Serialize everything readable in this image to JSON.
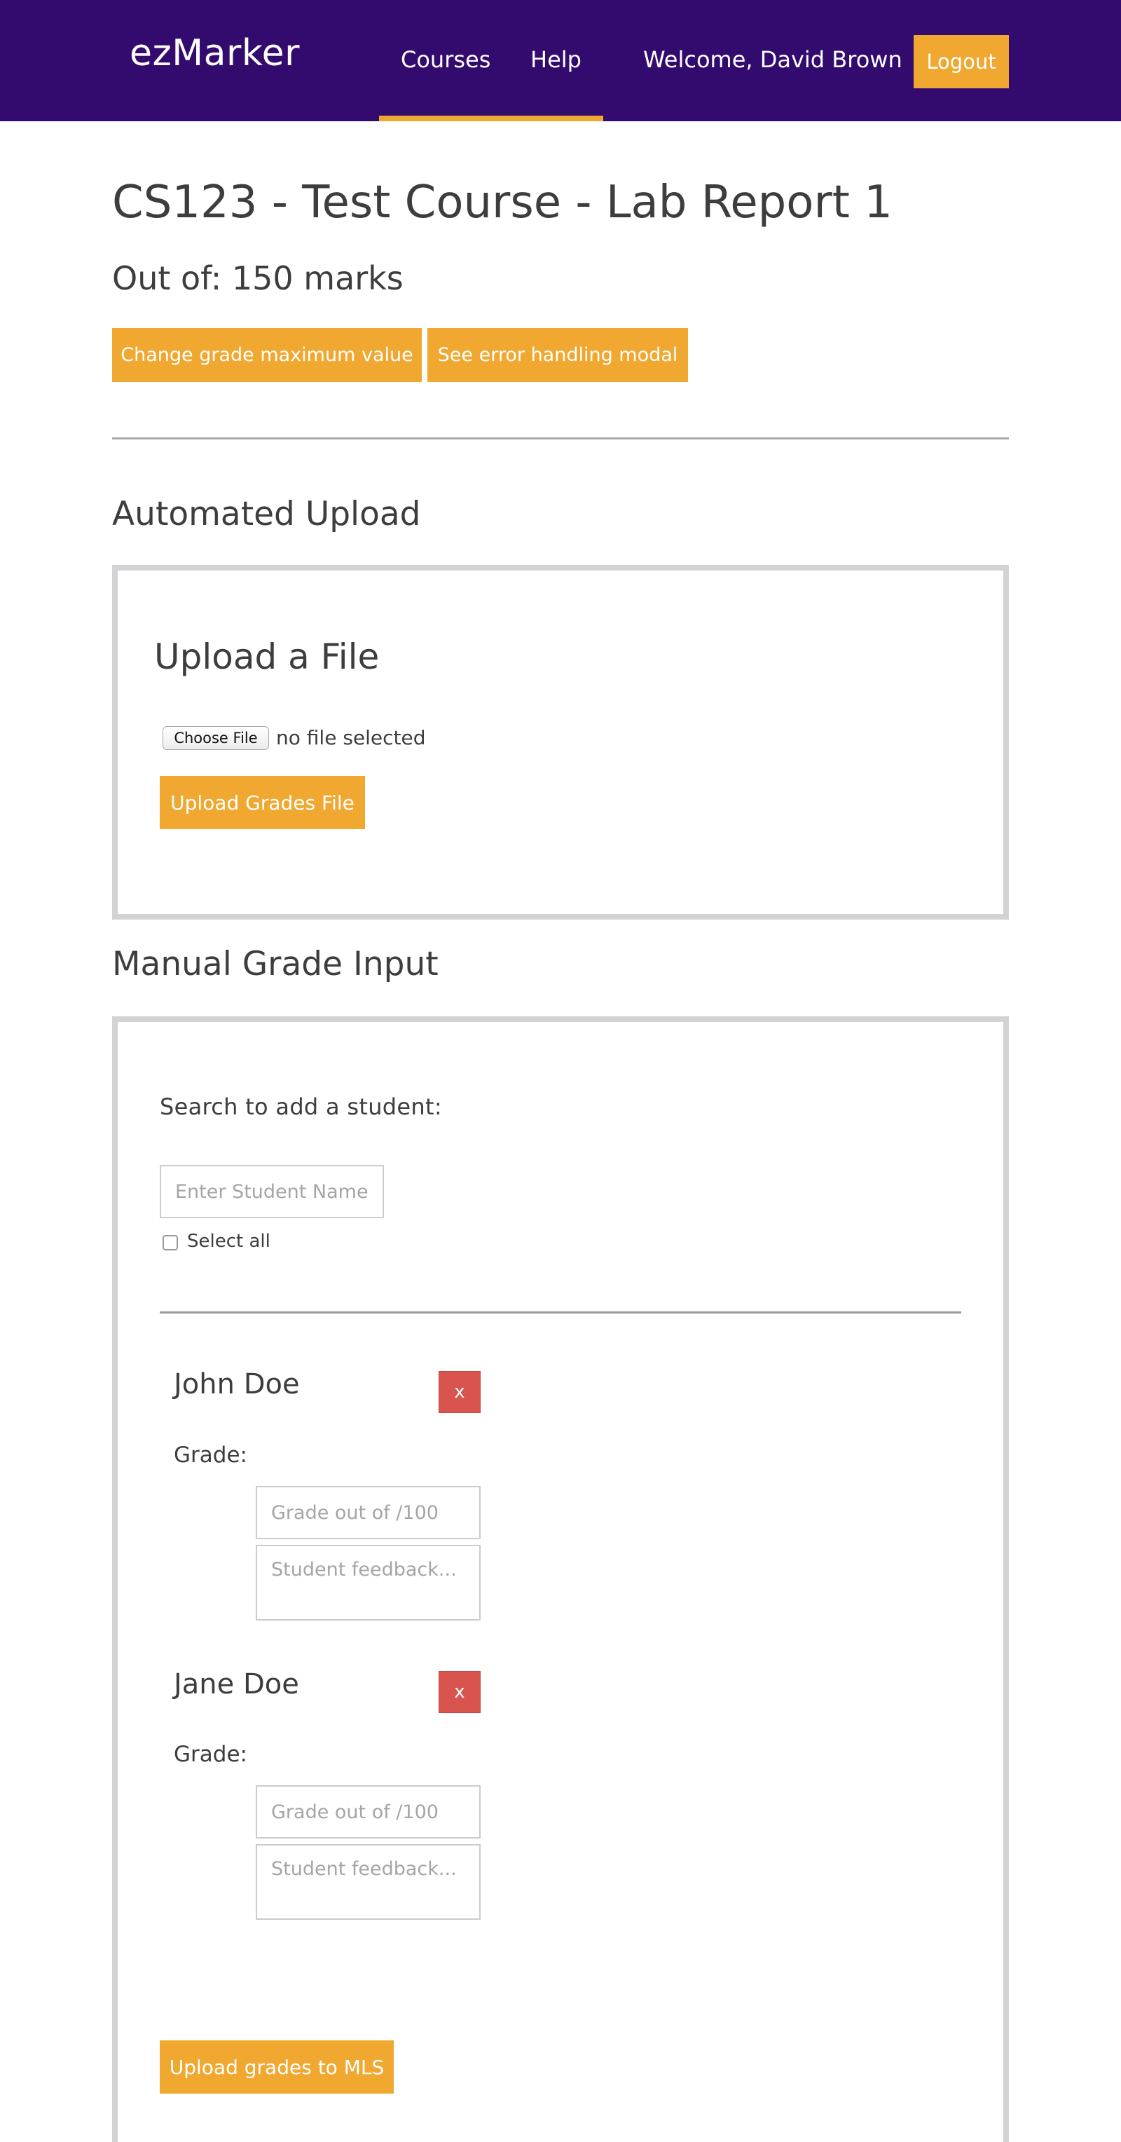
{
  "header": {
    "brand": "ezMarker",
    "nav": [
      {
        "label": "Courses"
      },
      {
        "label": "Help"
      }
    ],
    "welcome": "Welcome, David Brown",
    "logout_label": "Logout",
    "bar_color": "#330a6e",
    "accent_color": "#f0a830"
  },
  "page": {
    "title": "CS123 - Test Course - Lab Report 1",
    "out_of": "Out of: 150 marks",
    "change_max_label": "Change grade maximum value",
    "error_modal_label": "See error handling modal"
  },
  "automated_upload": {
    "section_title": "Automated Upload",
    "heading": "Upload a File",
    "choose_file_label": "Choose File",
    "file_status": "no file selected",
    "upload_label": "Upload Grades File"
  },
  "manual_input": {
    "section_title": "Manual Grade Input",
    "search_label": "Search to add a student:",
    "search_placeholder": "Enter Student Name or Number",
    "select_all_label": "Select all",
    "students": [
      {
        "name": "John Doe",
        "remove_label": "x",
        "grade_label": "Grade:",
        "grade_placeholder": "Grade out of /100",
        "feedback_placeholder": "Student feedback..."
      },
      {
        "name": "Jane Doe",
        "remove_label": "x",
        "grade_label": "Grade:",
        "grade_placeholder": "Grade out of /100",
        "feedback_placeholder": "Student feedback..."
      }
    ],
    "upload_mls_label": "Upload grades to MLS",
    "remove_color": "#d9534f"
  }
}
